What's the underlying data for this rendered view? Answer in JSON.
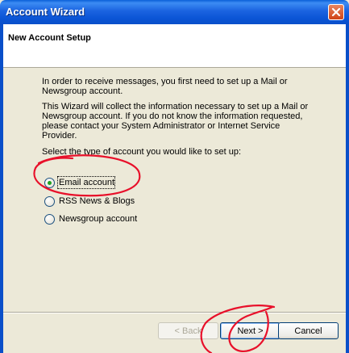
{
  "window": {
    "title": "Account Wizard",
    "close_icon": "close-icon"
  },
  "header": {
    "title": "New Account Setup"
  },
  "main": {
    "intro_1": "In order to receive messages, you first need to set up a Mail or Newsgroup account.",
    "intro_2": "This Wizard will collect the information necessary to set up a Mail or Newsgroup account. If you do not know the information requested, please contact your System Administrator or Internet Service Provider.",
    "prompt": "Select the type of account you would like to set up:",
    "options": [
      {
        "label": "Email account",
        "selected": true
      },
      {
        "label": "RSS News & Blogs",
        "selected": false
      },
      {
        "label": "Newsgroup account",
        "selected": false
      }
    ]
  },
  "buttons": {
    "back": "< Back",
    "next": "Next >",
    "cancel": "Cancel"
  },
  "colors": {
    "titlebar": "#0A4FC9",
    "dialog_bg": "#ECE9D8",
    "annotation": "#E8102A",
    "radio_dot": "#21A121"
  }
}
